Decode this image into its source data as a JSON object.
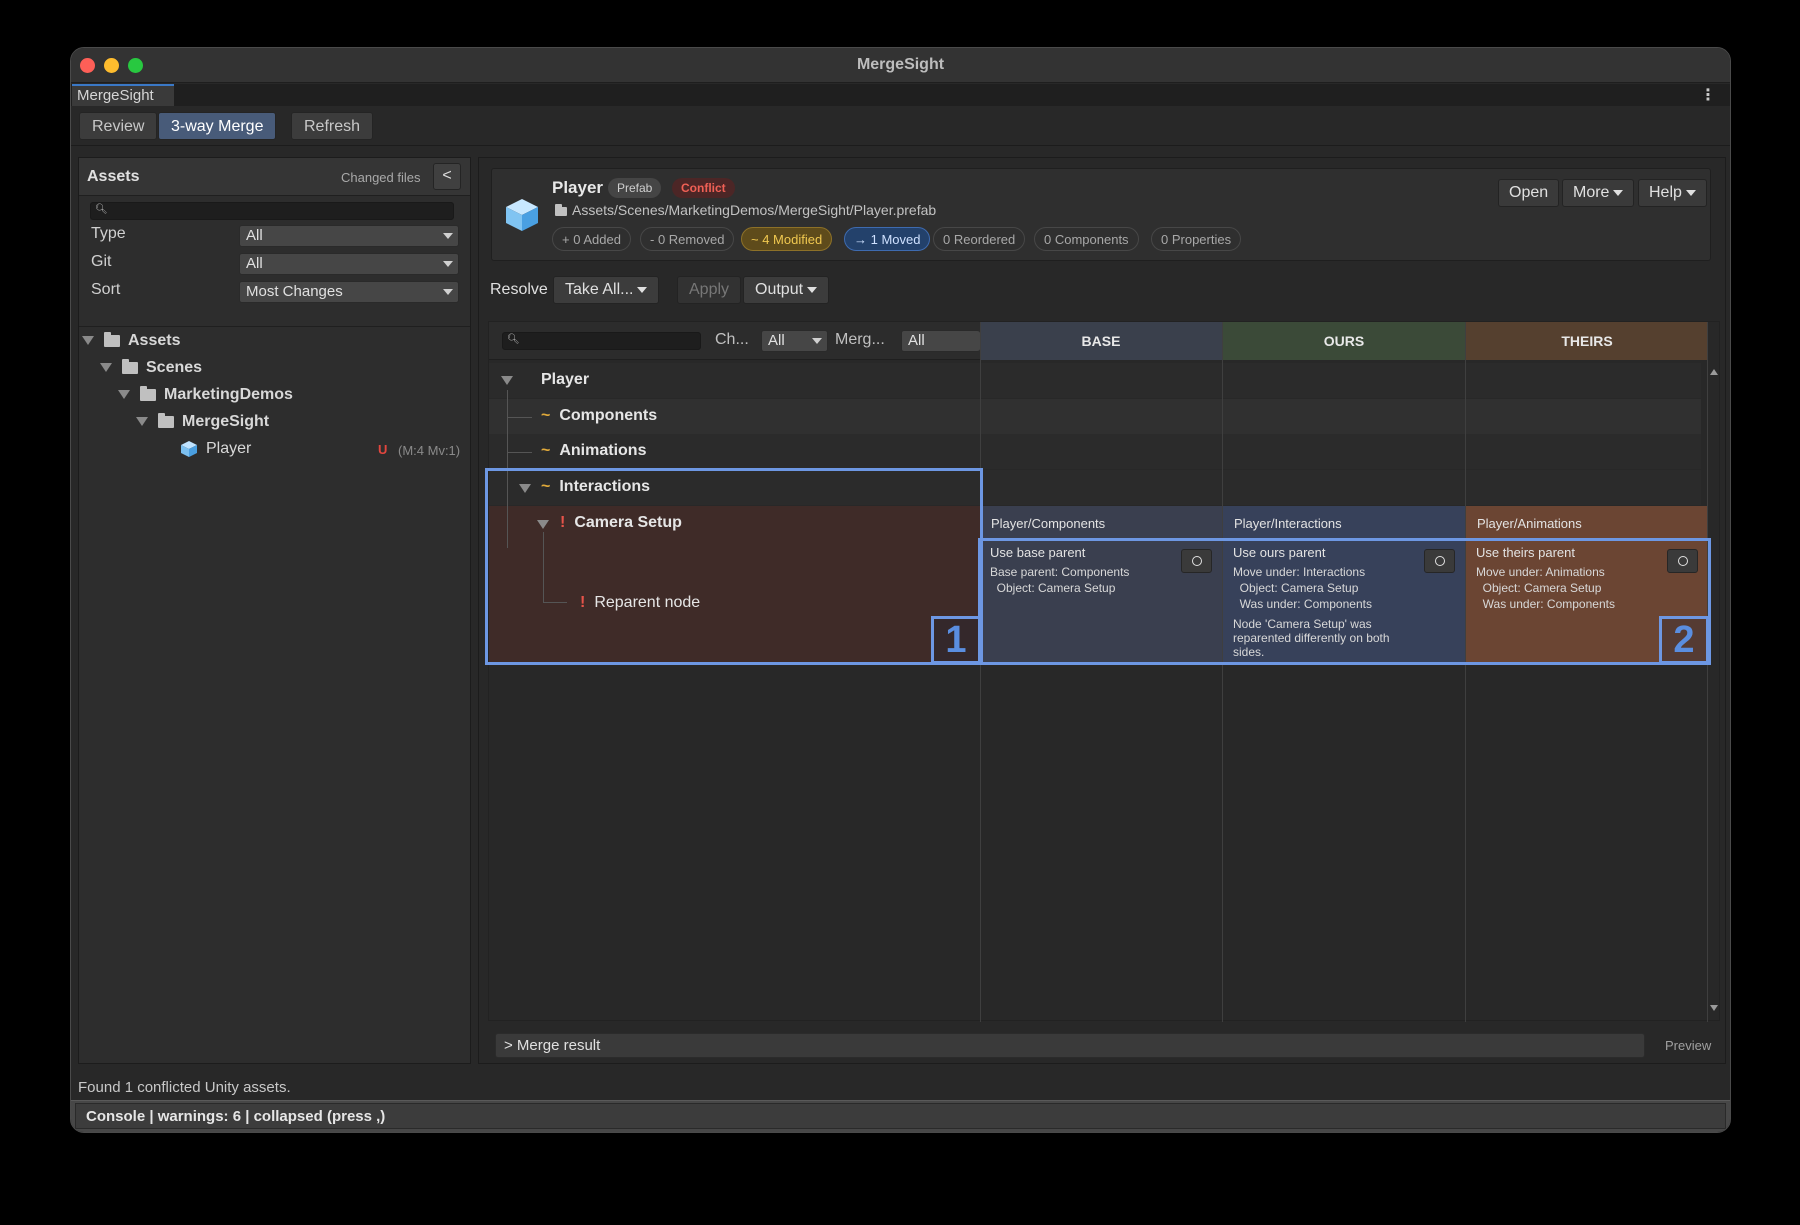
{
  "window": {
    "title": "MergeSight",
    "doc_tab": "MergeSight"
  },
  "modes": {
    "review": "Review",
    "merge": "3-way Merge",
    "refresh": "Refresh"
  },
  "left": {
    "title": "Assets",
    "changed_label": "Changed files",
    "back_label": "<",
    "filters": [
      {
        "label": "Type",
        "value": "All"
      },
      {
        "label": "Git",
        "value": "All"
      },
      {
        "label": "Sort",
        "value": "Most Changes"
      }
    ],
    "tree": [
      {
        "label": "Assets"
      },
      {
        "label": "Scenes"
      },
      {
        "label": "MarketingDemos"
      },
      {
        "label": "MergeSight"
      },
      {
        "label": "Player",
        "badge": "U",
        "meta": "(M:4 Mv:1)"
      }
    ]
  },
  "asset": {
    "name": "Player",
    "tag_prefab": "Prefab",
    "tag_conflict": "Conflict",
    "path": "Assets/Scenes/MarketingDemos/MergeSight/Player.prefab",
    "stats": {
      "added": "+ 0 Added",
      "removed": "- 0 Removed",
      "modified": "~ 4 Modified",
      "moved": "→ 1 Moved",
      "reordered": "0 Reordered",
      "components": "0 Components",
      "properties": "0 Properties"
    },
    "buttons": {
      "open": "Open",
      "more": "More",
      "help": "Help"
    }
  },
  "resolve": {
    "label": "Resolve",
    "take_all": "Take All...",
    "apply": "Apply",
    "output": "Output"
  },
  "grid": {
    "ch_label": "Ch...",
    "ch_value": "All",
    "merge_label": "Merg...",
    "merge_value": "All",
    "columns": {
      "base": "BASE",
      "ours": "OURS",
      "theirs": "THEIRS"
    },
    "rows": {
      "player": "Player",
      "components": "Components",
      "animations": "Animations",
      "interactions": "Interactions",
      "camera_setup": "Camera Setup",
      "reparent": "Reparent node"
    },
    "camera_paths": {
      "base": "Player/Components",
      "ours": "Player/Interactions",
      "theirs": "Player/Animations"
    },
    "cells": {
      "base": {
        "title": "Use base parent",
        "body": "Base parent: Components\n  Object: Camera Setup"
      },
      "ours": {
        "title": "Use ours parent",
        "body": "Move under: Interactions\n  Object: Camera Setup\n  Was under: Components",
        "note": "Node 'Camera Setup' was\nreparented differently on both\nsides."
      },
      "theirs": {
        "title": "Use theirs parent",
        "body": "Move under: Animations\n  Object: Camera Setup\n  Was under: Components"
      }
    },
    "callouts": {
      "one": "1",
      "two": "2"
    }
  },
  "footer": {
    "merge_result": "> Merge result",
    "preview": "Preview",
    "status": "Found 1 conflicted Unity assets.",
    "console": "Console | warnings: 6 | collapsed (press ,)"
  },
  "colors": {
    "base_header": "#3a404c",
    "ours_header": "#3b4a38",
    "theirs_header": "#55402f",
    "conflict_row": "#3f2b28",
    "base_cell": "#3a3f4f",
    "ours_cell": "#37415a",
    "theirs_cell": "#6b4533",
    "highlight": "#6d97e3",
    "modified": "#f0c850",
    "moved": "#3e6bb0"
  },
  "icons": [
    "cube-icon",
    "folder-icon",
    "search-icon",
    "kebab-menu-icon",
    "radio-icon"
  ]
}
